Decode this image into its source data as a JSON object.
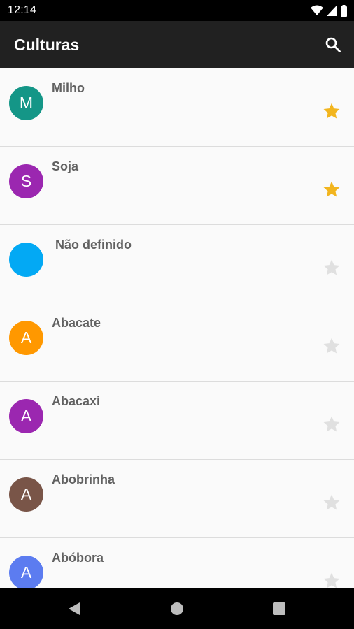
{
  "status": {
    "time": "12:14"
  },
  "appbar": {
    "title": "Culturas",
    "search_icon": "search-icon"
  },
  "crops": [
    {
      "name": "Milho",
      "initial": "M",
      "color": "#149687",
      "favorite": true
    },
    {
      "name": "Soja",
      "initial": "S",
      "color": "#9b27b0",
      "favorite": true
    },
    {
      "name": " Não definido",
      "initial": "",
      "color": "#03a9f4",
      "favorite": false
    },
    {
      "name": "Abacate",
      "initial": "A",
      "color": "#ff9800",
      "favorite": false
    },
    {
      "name": "Abacaxi",
      "initial": "A",
      "color": "#9b27b0",
      "favorite": false
    },
    {
      "name": "Abobrinha",
      "initial": "A",
      "color": "#795548",
      "favorite": false
    },
    {
      "name": "Abóbora",
      "initial": "A",
      "color": "#5c7cf0",
      "favorite": false
    }
  ],
  "colors": {
    "star_on": "#f2b51e",
    "star_off": "#e0e0e0",
    "appbar": "#212121"
  },
  "navbar": {
    "icons": [
      "back-icon",
      "home-icon",
      "recents-icon"
    ]
  }
}
